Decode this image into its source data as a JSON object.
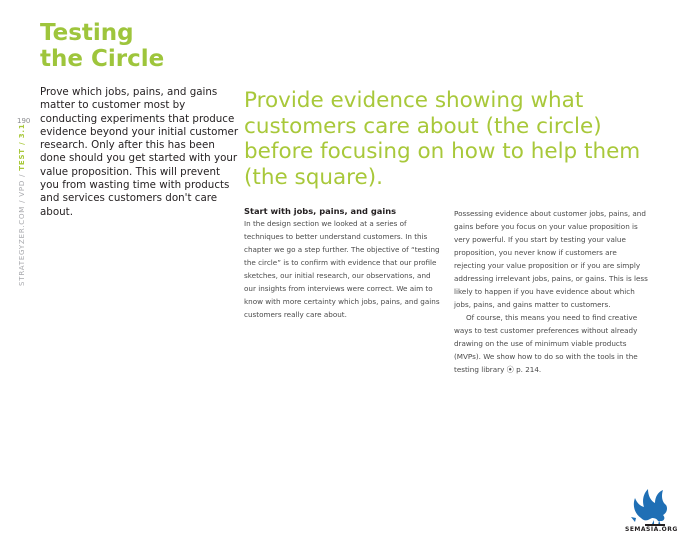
{
  "margin": {
    "page_number": "190",
    "section_prefix": "STRATEGYZER.COM / VPD / ",
    "section_accent": "TEST / 3.1"
  },
  "title": {
    "line1": "Testing",
    "line2": "the Circle"
  },
  "intro": "Prove which jobs, pains, and gains matter to customer most by conducting experiments that produce evidence beyond your initial customer research. Only after this has been done should you get started with your value proposition. This will prevent you from wasting time with products and services customers don't care about.",
  "headline": "Provide evidence showing what customers care about (the circle) before focusing on how to help them (the square).",
  "column1": {
    "subhead": "Start with jobs, pains, and gains",
    "body": "In the design section we looked at a series of techniques to better understand customers. In this chapter we go a step further. The objective of “testing the circle” is to confirm with evidence that our profile sketches, our initial research, our observations, and our insights from interviews were correct. We aim to know with more certainty which jobs, pains, and gains customers really care about."
  },
  "column2": {
    "para1": "Possessing evidence about customer jobs, pains, and gains before you focus on your value proposition is very powerful. If you start by testing your value proposition, you never know if customers are rejecting your value proposition or if you are simply addressing irrelevant jobs, pains, or gains. This is less likely to happen if you have evidence about which jobs, pains, and gains matter to customers.",
    "para2": "Of course, this means you need to find creative ways to test customer preferences without already drawing on the use of minimum viable products (MVPs). We show how to do so with the tools in the testing library ⦿ p. 214."
  },
  "logo": {
    "icon": "griffin-logo-icon",
    "text": "SEMASIA.ORG"
  },
  "colors": {
    "accent_green": "#9ec53c",
    "body_text": "#231f20",
    "logo_blue": "#1f6fb5"
  }
}
